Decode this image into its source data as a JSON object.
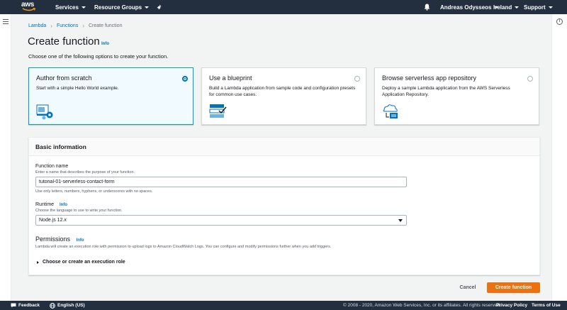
{
  "topnav": {
    "logo_text": "aws",
    "services": "Services",
    "resource_groups": "Resource Groups",
    "user": "Andreas Odysseos",
    "region": "Ireland",
    "support": "Support"
  },
  "breadcrumb": {
    "items": [
      "Lambda",
      "Functions"
    ],
    "current": "Create function"
  },
  "page": {
    "title": "Create function",
    "info": "Info",
    "description": "Choose one of the following options to create your function."
  },
  "options": [
    {
      "title": "Author from scratch",
      "desc": "Start with a simple Hello World example.",
      "selected": true
    },
    {
      "title": "Use a blueprint",
      "desc": "Build a Lambda application from sample code and configuration presets for common use cases.",
      "selected": false
    },
    {
      "title": "Browse serverless app repository",
      "desc": "Deploy a sample Lambda application from the AWS Serverless Application Repository.",
      "selected": false
    }
  ],
  "basic": {
    "title": "Basic information",
    "function_name_label": "Function name",
    "function_name_help": "Enter a name that describes the purpose of your function.",
    "function_name_value": "tutorial-01-serverless-contact-form",
    "function_name_constraint": "Use only letters, numbers, hyphens, or underscores with no spaces.",
    "runtime_label": "Runtime",
    "runtime_info": "Info",
    "runtime_help": "Choose the language to use to write your function.",
    "runtime_value": "Node.js 12.x",
    "permissions_label": "Permissions",
    "permissions_info": "Info",
    "permissions_help": "Lambda will create an execution role with permission to upload logs to Amazon CloudWatch Logs. You can configure and modify permissions further when you add triggers.",
    "execution_role": "Choose or create an execution role"
  },
  "actions": {
    "cancel": "Cancel",
    "create": "Create function"
  },
  "footer": {
    "feedback": "Feedback",
    "language": "English (US)",
    "copyright": "© 2008 - 2020, Amazon Web Services, Inc. or its affiliates. All rights reserved.",
    "privacy": "Privacy Policy",
    "terms": "Terms of Use"
  },
  "colors": {
    "nav_bg": "#232f3e",
    "accent_orange": "#ec7211",
    "link_blue": "#0073bb",
    "selected_border": "#00a1c9"
  }
}
